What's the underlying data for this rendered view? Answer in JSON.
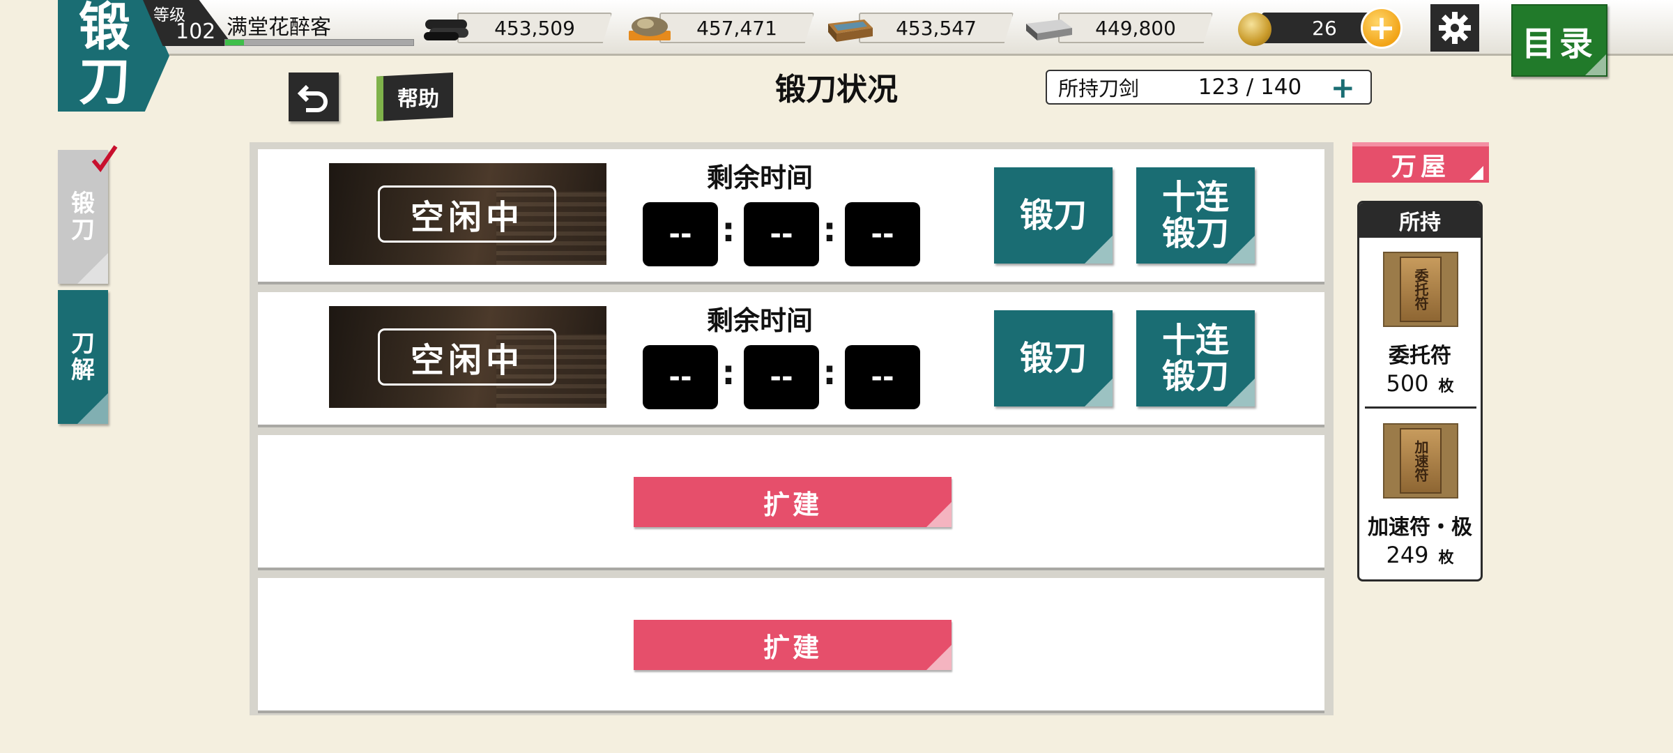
{
  "header": {
    "page_tag": [
      "锻",
      "刀"
    ],
    "level_label": "等级",
    "level_value": "102",
    "player_name": "满堂花醉客",
    "exp_progress": 0.1
  },
  "resources": [
    {
      "icon": "charcoal-icon",
      "value": "453,509"
    },
    {
      "icon": "jewel-steel-icon",
      "value": "457,471"
    },
    {
      "icon": "cooling-material-icon",
      "value": "453,547"
    },
    {
      "icon": "whetstone-icon",
      "value": "449,800"
    }
  ],
  "coins": {
    "icon": "koban-coin-icon",
    "value": "26",
    "add_label": "+"
  },
  "menu_label": "目录",
  "subheader": {
    "help_label": "帮助",
    "title": "锻刀状况",
    "sword_count_label": "所持刀剑",
    "sword_count_value": "123 / 140",
    "sword_count_plus": "+"
  },
  "side_tabs": [
    {
      "label": "锻\n刀",
      "active": true
    },
    {
      "label": "刀\n解",
      "active": false
    }
  ],
  "slots": [
    {
      "status": "空闲中",
      "timer_label": "剩余时间",
      "hours": "--",
      "minutes": "--",
      "seconds": "--",
      "forge_label": "锻刀",
      "forge10_label": "十连\n锻刀"
    },
    {
      "status": "空闲中",
      "timer_label": "剩余时间",
      "hours": "--",
      "minutes": "--",
      "seconds": "--",
      "forge_label": "锻刀",
      "forge10_label": "十连\n锻刀"
    }
  ],
  "expand_slots": [
    {
      "label": "扩建"
    },
    {
      "label": "扩建"
    }
  ],
  "shop": {
    "tag": "万屋",
    "inventory_header": "所持",
    "items": [
      {
        "tile_text": "委托符",
        "name": "委托符",
        "qty": "500",
        "unit": "枚"
      },
      {
        "tile_text": "加速符",
        "name": "加速符・极",
        "qty": "249",
        "unit": "枚"
      }
    ]
  },
  "colors": {
    "teal": "#1a6d73",
    "pink": "#e64f6b",
    "green": "#217a2a",
    "background": "#f4efdf"
  }
}
